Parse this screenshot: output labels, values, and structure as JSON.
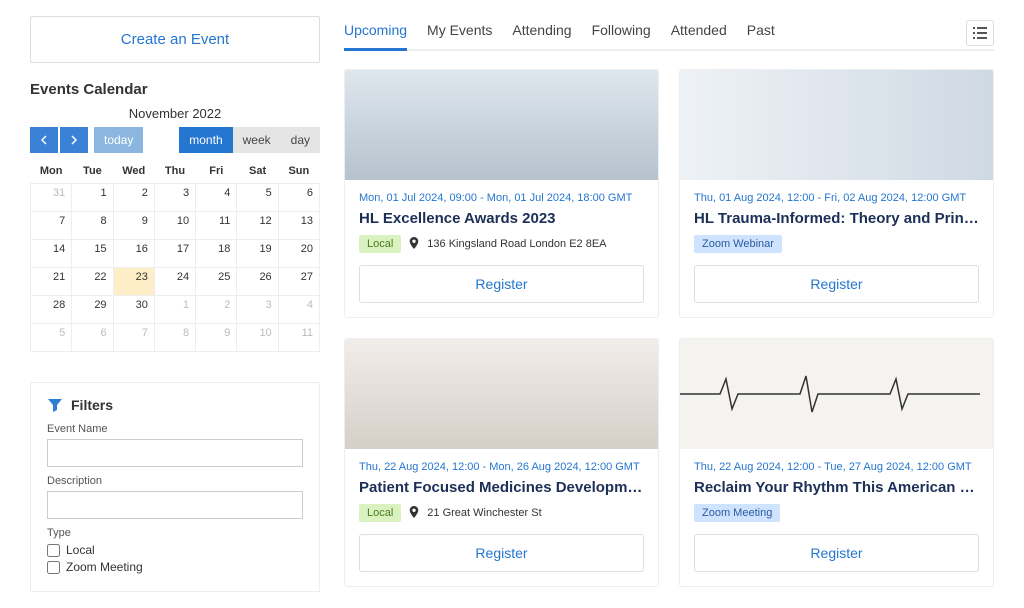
{
  "create_button_label": "Create an Event",
  "calendar": {
    "title": "Events Calendar",
    "month_label": "November 2022",
    "today_label": "today",
    "views": {
      "month": "month",
      "week": "week",
      "day": "day"
    },
    "weekdays": [
      "Mon",
      "Tue",
      "Wed",
      "Thu",
      "Fri",
      "Sat",
      "Sun"
    ],
    "weeks": [
      [
        {
          "n": "31",
          "out": true
        },
        {
          "n": "1"
        },
        {
          "n": "2"
        },
        {
          "n": "3"
        },
        {
          "n": "4"
        },
        {
          "n": "5"
        },
        {
          "n": "6"
        }
      ],
      [
        {
          "n": "7"
        },
        {
          "n": "8"
        },
        {
          "n": "9"
        },
        {
          "n": "10"
        },
        {
          "n": "11"
        },
        {
          "n": "12"
        },
        {
          "n": "13"
        }
      ],
      [
        {
          "n": "14"
        },
        {
          "n": "15"
        },
        {
          "n": "16"
        },
        {
          "n": "17"
        },
        {
          "n": "18"
        },
        {
          "n": "19"
        },
        {
          "n": "20"
        }
      ],
      [
        {
          "n": "21"
        },
        {
          "n": "22"
        },
        {
          "n": "23",
          "today": true
        },
        {
          "n": "24"
        },
        {
          "n": "25"
        },
        {
          "n": "26"
        },
        {
          "n": "27"
        }
      ],
      [
        {
          "n": "28"
        },
        {
          "n": "29"
        },
        {
          "n": "30"
        },
        {
          "n": "1",
          "out": true
        },
        {
          "n": "2",
          "out": true
        },
        {
          "n": "3",
          "out": true
        },
        {
          "n": "4",
          "out": true
        }
      ],
      [
        {
          "n": "5",
          "out": true
        },
        {
          "n": "6",
          "out": true
        },
        {
          "n": "7",
          "out": true
        },
        {
          "n": "8",
          "out": true
        },
        {
          "n": "9",
          "out": true
        },
        {
          "n": "10",
          "out": true
        },
        {
          "n": "11",
          "out": true
        }
      ]
    ]
  },
  "filters": {
    "title": "Filters",
    "labels": {
      "event_name": "Event Name",
      "description": "Description",
      "type": "Type"
    },
    "type_options": [
      "Local",
      "Zoom Meeting"
    ]
  },
  "tabs": [
    "Upcoming",
    "My Events",
    "Attending",
    "Following",
    "Attended",
    "Past"
  ],
  "events": [
    {
      "date_range": "Mon, 01 Jul 2024, 09:00 - Mon, 01 Jul 2024, 18:00 GMT",
      "title": "HL Excellence Awards 2023",
      "badge": "Local",
      "badge_class": "local",
      "location": "136 Kingsland Road London E2 8EA",
      "register_label": "Register",
      "img_class": "img-audience"
    },
    {
      "date_range": "Thu, 01 Aug 2024, 12:00 - Fri, 02 Aug 2024, 12:00 GMT",
      "title": "HL Trauma-Informed: Theory and Principles",
      "badge": "Zoom Webinar",
      "badge_class": "zoomw",
      "location": "",
      "register_label": "Register",
      "img_class": "img-nurses"
    },
    {
      "date_range": "Thu, 22 Aug 2024, 12:00 - Mon, 26 Aug 2024, 12:00 GMT",
      "title": "Patient Focused Medicines Development Confer…",
      "badge": "Local",
      "badge_class": "local",
      "location": "21 Great Winchester St",
      "register_label": "Register",
      "img_class": "img-team"
    },
    {
      "date_range": "Thu, 22 Aug 2024, 12:00 - Tue, 27 Aug 2024, 12:00 GMT",
      "title": "Reclaim Your Rhythm This American Heart Month",
      "badge": "Zoom Meeting",
      "badge_class": "zoomm",
      "location": "",
      "register_label": "Register",
      "img_class": "img-ekg"
    }
  ]
}
